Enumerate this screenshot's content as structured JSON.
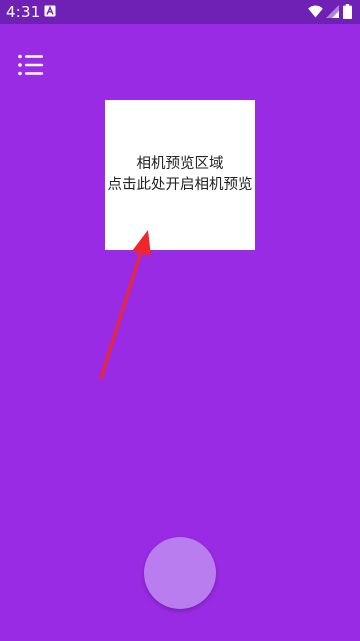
{
  "status_bar": {
    "time": "4:31",
    "icons": [
      "notification-a-icon",
      "wifi-icon",
      "signal-icon",
      "battery-icon"
    ]
  },
  "toolbar": {
    "menu_icon": "list-menu-icon"
  },
  "camera_preview": {
    "title": "相机预览区域",
    "hint": "点击此处开启相机预览"
  },
  "annotation": {
    "arrow_color": "#f0262d"
  },
  "capture": {
    "shutter_icon": "shutter-button"
  },
  "colors": {
    "background": "#9a2be5",
    "status_bar": "#6f20b5",
    "shutter": "#b97df0",
    "preview_background": "#ffffff"
  }
}
